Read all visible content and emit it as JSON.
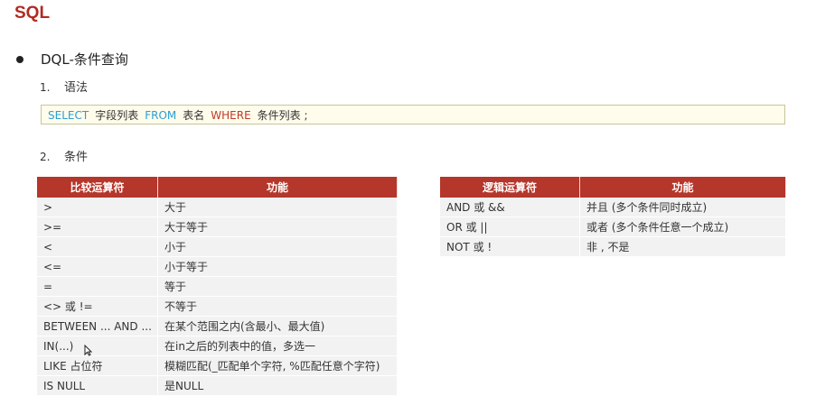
{
  "title": "SQL",
  "bullet": "DQL-条件查询",
  "step1": {
    "num": "1.",
    "label": "语法"
  },
  "syntax": {
    "select": "SELECT",
    "fields": "字段列表",
    "from": "FROM",
    "table": "表名",
    "where": "WHERE",
    "cond": "条件列表 ;"
  },
  "step2": {
    "num": "2.",
    "label": "条件"
  },
  "comparison_table": {
    "headers": [
      "比较运算符",
      "功能"
    ],
    "rows": [
      [
        ">",
        "大于"
      ],
      [
        ">=",
        "大于等于"
      ],
      [
        "<",
        "小于"
      ],
      [
        "<=",
        "小于等于"
      ],
      [
        "=",
        "等于"
      ],
      [
        "<> 或 !=",
        "不等于"
      ],
      [
        "BETWEEN ... AND ...",
        "在某个范围之内(含最小、最大值)"
      ],
      [
        "IN(...)",
        "在in之后的列表中的值，多选一"
      ],
      [
        "LIKE 占位符",
        "模糊匹配(_匹配单个字符, %匹配任意个字符)"
      ],
      [
        "IS NULL",
        "是NULL"
      ]
    ]
  },
  "logic_table": {
    "headers": [
      "逻辑运算符",
      "功能"
    ],
    "rows": [
      [
        "AND 或 &&",
        "并且 (多个条件同时成立)"
      ],
      [
        "OR 或 ||",
        "或者 (多个条件任意一个成立)"
      ],
      [
        "NOT 或 !",
        "非 , 不是"
      ]
    ]
  },
  "colors": {
    "accent": "#b22a22",
    "header_bg": "#b5362a",
    "code_bg": "#fffceb",
    "keyword_blue": "#2a9fd6",
    "keyword_red": "#c0392b"
  }
}
